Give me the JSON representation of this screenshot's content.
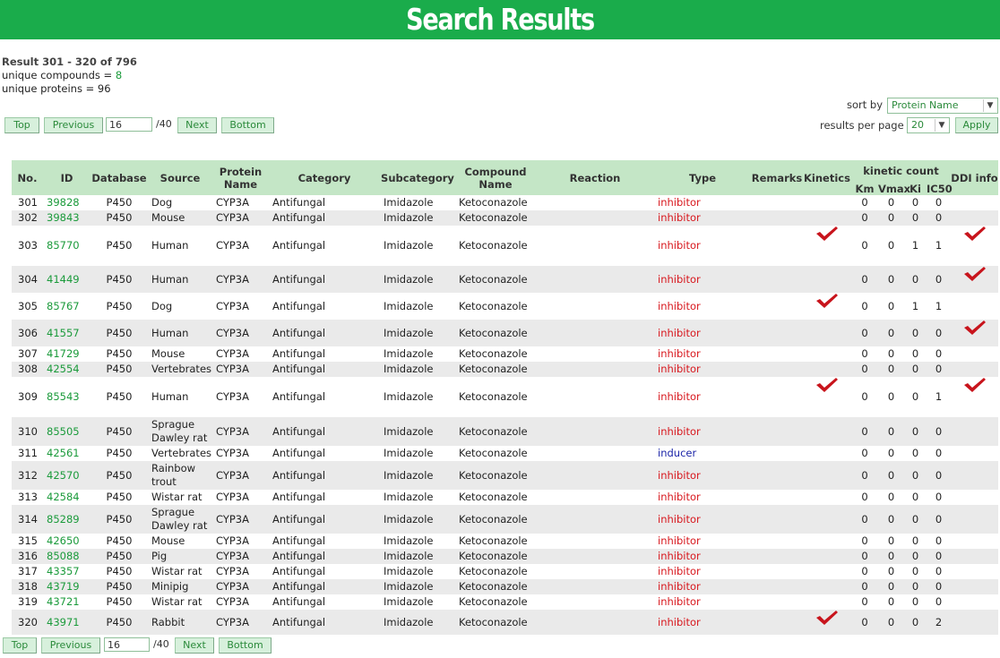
{
  "header": {
    "title": "Search Results"
  },
  "summary": {
    "result_line": "Result 301 - 320 of 796",
    "compounds_label": "unique compounds = ",
    "compounds_value": "8",
    "proteins_line": "unique proteins = 96"
  },
  "pager": {
    "top": "Top",
    "previous": "Previous",
    "next": "Next",
    "bottom": "Bottom",
    "page": "16",
    "total": "/40"
  },
  "controls": {
    "sort_label": "sort by",
    "sort_value": "Protein Name",
    "rpp_label": "results per page",
    "rpp_value": "20",
    "apply": "Apply"
  },
  "table": {
    "headers": {
      "no": "No.",
      "id": "ID",
      "database": "Database",
      "source": "Source",
      "protein": "Protein Name",
      "category": "Category",
      "subcategory": "Subcategory",
      "compound": "Compound Name",
      "reaction": "Reaction",
      "type": "Type",
      "remarks": "Remarks",
      "kinetics": "Kinetics",
      "kinetic_count": "kinetic count",
      "km": "Km",
      "vmax": "Vmax",
      "ki": "Ki",
      "ic50": "IC50",
      "ddi": "DDI info"
    },
    "rows": [
      {
        "no": "301",
        "id": "39828",
        "database": "P450",
        "source": "Dog",
        "protein": "CYP3A",
        "category": "Antifungal",
        "subcategory": "Imidazole",
        "compound": "Ketoconazole",
        "reaction": "",
        "type": "inhibitor",
        "remarks": "",
        "kinetics": false,
        "km": "0",
        "vmax": "0",
        "ki": "0",
        "ic50": "0",
        "ddi": false
      },
      {
        "no": "302",
        "id": "39843",
        "database": "P450",
        "source": "Mouse",
        "protein": "CYP3A",
        "category": "Antifungal",
        "subcategory": "Imidazole",
        "compound": "Ketoconazole",
        "reaction": "",
        "type": "inhibitor",
        "remarks": "",
        "kinetics": false,
        "km": "0",
        "vmax": "0",
        "ki": "0",
        "ic50": "0",
        "ddi": false
      },
      {
        "no": "303",
        "id": "85770",
        "database": "P450",
        "source": "Human",
        "protein": "CYP3A",
        "category": "Antifungal",
        "subcategory": "Imidazole",
        "compound": "Ketoconazole",
        "reaction": "",
        "type": "inhibitor",
        "remarks": "",
        "kinetics": true,
        "km": "0",
        "vmax": "0",
        "ki": "1",
        "ic50": "1",
        "ddi": true
      },
      {
        "no": "304",
        "id": "41449",
        "database": "P450",
        "source": "Human",
        "protein": "CYP3A",
        "category": "Antifungal",
        "subcategory": "Imidazole",
        "compound": "Ketoconazole",
        "reaction": "",
        "type": "inhibitor",
        "remarks": "",
        "kinetics": false,
        "km": "0",
        "vmax": "0",
        "ki": "0",
        "ic50": "0",
        "ddi": true
      },
      {
        "no": "305",
        "id": "85767",
        "database": "P450",
        "source": "Dog",
        "protein": "CYP3A",
        "category": "Antifungal",
        "subcategory": "Imidazole",
        "compound": "Ketoconazole",
        "reaction": "",
        "type": "inhibitor",
        "remarks": "",
        "kinetics": true,
        "km": "0",
        "vmax": "0",
        "ki": "1",
        "ic50": "1",
        "ddi": false
      },
      {
        "no": "306",
        "id": "41557",
        "database": "P450",
        "source": "Human",
        "protein": "CYP3A",
        "category": "Antifungal",
        "subcategory": "Imidazole",
        "compound": "Ketoconazole",
        "reaction": "",
        "type": "inhibitor",
        "remarks": "",
        "kinetics": false,
        "km": "0",
        "vmax": "0",
        "ki": "0",
        "ic50": "0",
        "ddi": true
      },
      {
        "no": "307",
        "id": "41729",
        "database": "P450",
        "source": "Mouse",
        "protein": "CYP3A",
        "category": "Antifungal",
        "subcategory": "Imidazole",
        "compound": "Ketoconazole",
        "reaction": "",
        "type": "inhibitor",
        "remarks": "",
        "kinetics": false,
        "km": "0",
        "vmax": "0",
        "ki": "0",
        "ic50": "0",
        "ddi": false
      },
      {
        "no": "308",
        "id": "42554",
        "database": "P450",
        "source": "Vertebrates",
        "protein": "CYP3A",
        "category": "Antifungal",
        "subcategory": "Imidazole",
        "compound": "Ketoconazole",
        "reaction": "",
        "type": "inhibitor",
        "remarks": "",
        "kinetics": false,
        "km": "0",
        "vmax": "0",
        "ki": "0",
        "ic50": "0",
        "ddi": false
      },
      {
        "no": "309",
        "id": "85543",
        "database": "P450",
        "source": "Human",
        "protein": "CYP3A",
        "category": "Antifungal",
        "subcategory": "Imidazole",
        "compound": "Ketoconazole",
        "reaction": "",
        "type": "inhibitor",
        "remarks": "",
        "kinetics": true,
        "km": "0",
        "vmax": "0",
        "ki": "0",
        "ic50": "1",
        "ddi": true
      },
      {
        "no": "310",
        "id": "85505",
        "database": "P450",
        "source": "Sprague Dawley rat",
        "protein": "CYP3A",
        "category": "Antifungal",
        "subcategory": "Imidazole",
        "compound": "Ketoconazole",
        "reaction": "",
        "type": "inhibitor",
        "remarks": "",
        "kinetics": false,
        "km": "0",
        "vmax": "0",
        "ki": "0",
        "ic50": "0",
        "ddi": false
      },
      {
        "no": "311",
        "id": "42561",
        "database": "P450",
        "source": "Vertebrates",
        "protein": "CYP3A",
        "category": "Antifungal",
        "subcategory": "Imidazole",
        "compound": "Ketoconazole",
        "reaction": "",
        "type": "inducer",
        "remarks": "",
        "kinetics": false,
        "km": "0",
        "vmax": "0",
        "ki": "0",
        "ic50": "0",
        "ddi": false
      },
      {
        "no": "312",
        "id": "42570",
        "database": "P450",
        "source": "Rainbow trout",
        "protein": "CYP3A",
        "category": "Antifungal",
        "subcategory": "Imidazole",
        "compound": "Ketoconazole",
        "reaction": "",
        "type": "inhibitor",
        "remarks": "",
        "kinetics": false,
        "km": "0",
        "vmax": "0",
        "ki": "0",
        "ic50": "0",
        "ddi": false
      },
      {
        "no": "313",
        "id": "42584",
        "database": "P450",
        "source": "Wistar rat",
        "protein": "CYP3A",
        "category": "Antifungal",
        "subcategory": "Imidazole",
        "compound": "Ketoconazole",
        "reaction": "",
        "type": "inhibitor",
        "remarks": "",
        "kinetics": false,
        "km": "0",
        "vmax": "0",
        "ki": "0",
        "ic50": "0",
        "ddi": false
      },
      {
        "no": "314",
        "id": "85289",
        "database": "P450",
        "source": "Sprague Dawley rat",
        "protein": "CYP3A",
        "category": "Antifungal",
        "subcategory": "Imidazole",
        "compound": "Ketoconazole",
        "reaction": "",
        "type": "inhibitor",
        "remarks": "",
        "kinetics": false,
        "km": "0",
        "vmax": "0",
        "ki": "0",
        "ic50": "0",
        "ddi": false
      },
      {
        "no": "315",
        "id": "42650",
        "database": "P450",
        "source": "Mouse",
        "protein": "CYP3A",
        "category": "Antifungal",
        "subcategory": "Imidazole",
        "compound": "Ketoconazole",
        "reaction": "",
        "type": "inhibitor",
        "remarks": "",
        "kinetics": false,
        "km": "0",
        "vmax": "0",
        "ki": "0",
        "ic50": "0",
        "ddi": false
      },
      {
        "no": "316",
        "id": "85088",
        "database": "P450",
        "source": "Pig",
        "protein": "CYP3A",
        "category": "Antifungal",
        "subcategory": "Imidazole",
        "compound": "Ketoconazole",
        "reaction": "",
        "type": "inhibitor",
        "remarks": "",
        "kinetics": false,
        "km": "0",
        "vmax": "0",
        "ki": "0",
        "ic50": "0",
        "ddi": false
      },
      {
        "no": "317",
        "id": "43357",
        "database": "P450",
        "source": "Wistar rat",
        "protein": "CYP3A",
        "category": "Antifungal",
        "subcategory": "Imidazole",
        "compound": "Ketoconazole",
        "reaction": "",
        "type": "inhibitor",
        "remarks": "",
        "kinetics": false,
        "km": "0",
        "vmax": "0",
        "ki": "0",
        "ic50": "0",
        "ddi": false
      },
      {
        "no": "318",
        "id": "43719",
        "database": "P450",
        "source": "Minipig",
        "protein": "CYP3A",
        "category": "Antifungal",
        "subcategory": "Imidazole",
        "compound": "Ketoconazole",
        "reaction": "",
        "type": "inhibitor",
        "remarks": "",
        "kinetics": false,
        "km": "0",
        "vmax": "0",
        "ki": "0",
        "ic50": "0",
        "ddi": false
      },
      {
        "no": "319",
        "id": "43721",
        "database": "P450",
        "source": "Wistar rat",
        "protein": "CYP3A",
        "category": "Antifungal",
        "subcategory": "Imidazole",
        "compound": "Ketoconazole",
        "reaction": "",
        "type": "inhibitor",
        "remarks": "",
        "kinetics": false,
        "km": "0",
        "vmax": "0",
        "ki": "0",
        "ic50": "0",
        "ddi": false
      },
      {
        "no": "320",
        "id": "43971",
        "database": "P450",
        "source": "Rabbit",
        "protein": "CYP3A",
        "category": "Antifungal",
        "subcategory": "Imidazole",
        "compound": "Ketoconazole",
        "reaction": "",
        "type": "inhibitor",
        "remarks": "",
        "kinetics": true,
        "km": "0",
        "vmax": "0",
        "ki": "0",
        "ic50": "2",
        "ddi": false
      }
    ]
  },
  "colors": {
    "banner": "#1aac4b",
    "header_row": "#c4e6c6",
    "inhibitor": "#d8181e",
    "inducer": "#1c25a8",
    "link": "#1a9a3a",
    "check": "#c8141c"
  },
  "icons": {
    "check": "red-checkmark-icon",
    "dropdown": "chevron-down-icon"
  }
}
